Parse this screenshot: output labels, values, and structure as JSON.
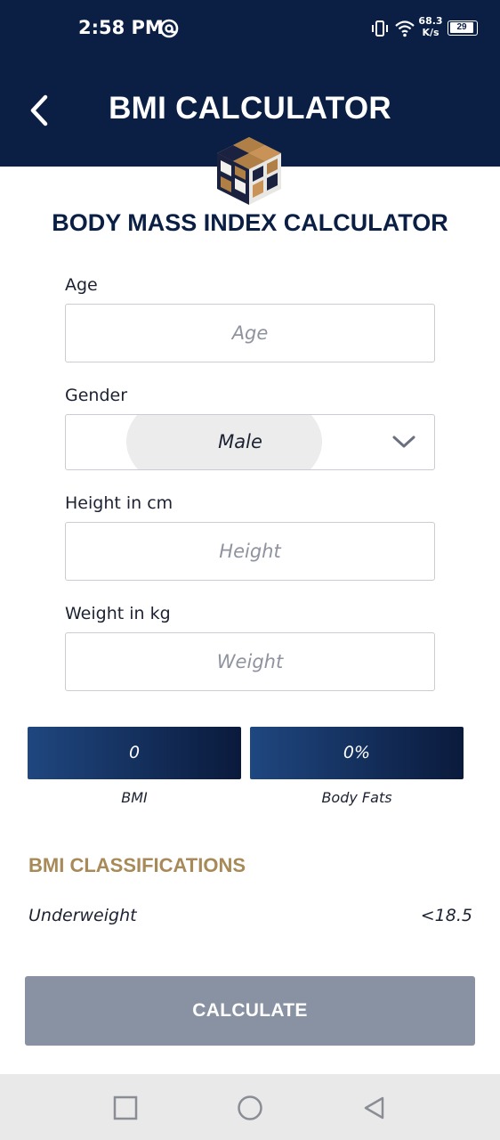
{
  "status_bar": {
    "time": "2:58 PM",
    "network_speed_value": "68.3",
    "network_speed_unit": "K/s",
    "battery": "29"
  },
  "header": {
    "title": "BMI CALCULATOR",
    "back_icon": "chevron-left-icon"
  },
  "heading": "BODY MASS INDEX CALCULATOR",
  "form": {
    "age": {
      "label": "Age",
      "placeholder": "Age",
      "value": ""
    },
    "gender": {
      "label": "Gender",
      "selected": "Male"
    },
    "height": {
      "label": "Height in cm",
      "placeholder": "Height",
      "value": ""
    },
    "weight": {
      "label": "Weight in kg",
      "placeholder": "Weight",
      "value": ""
    }
  },
  "results": {
    "bmi": {
      "value": "0",
      "caption": "BMI"
    },
    "body_fats": {
      "value": "0%",
      "caption": "Body Fats"
    }
  },
  "classifications": {
    "heading": "BMI CLASSIFICATIONS",
    "rows": [
      {
        "label": "Underweight",
        "value": "<18.5"
      }
    ]
  },
  "calculate_button": "CALCULATE",
  "colors": {
    "header_bg": "#0b1f45",
    "accent_gold": "#a88a58",
    "button_gray": "#8892a2",
    "result_gradient_start": "#1f4780",
    "result_gradient_end": "#0a1a3c"
  },
  "nav_bar": {
    "buttons": [
      "recent-apps-icon",
      "home-icon",
      "back-triangle-icon"
    ]
  }
}
